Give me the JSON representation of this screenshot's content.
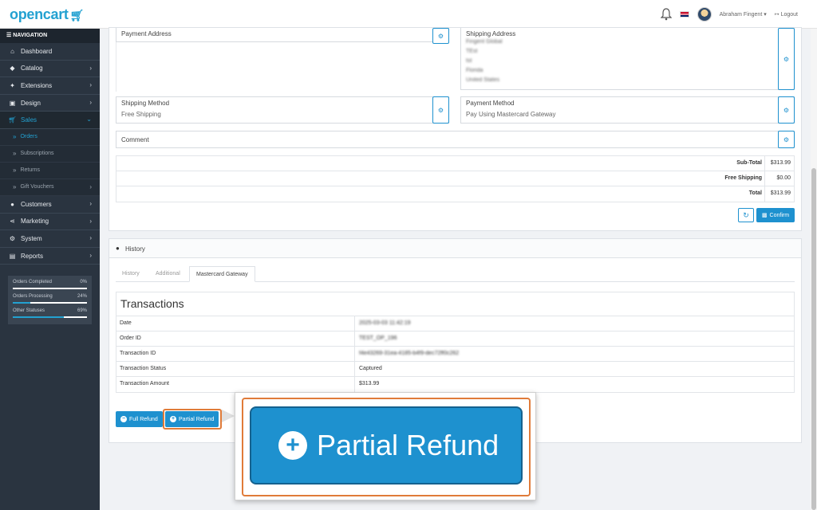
{
  "header": {
    "logo": "opencart",
    "user_name": "Abraham Fingent",
    "logout_label": "Logout"
  },
  "sidebar": {
    "heading": "NAVIGATION",
    "items": [
      {
        "label": "Dashboard",
        "icon": "home-icon"
      },
      {
        "label": "Catalog",
        "icon": "tag-icon"
      },
      {
        "label": "Extensions",
        "icon": "puzzle-icon"
      },
      {
        "label": "Design",
        "icon": "monitor-icon"
      },
      {
        "label": "Sales",
        "icon": "cart-icon"
      },
      {
        "label": "Customers",
        "icon": "user-icon"
      },
      {
        "label": "Marketing",
        "icon": "share-icon"
      },
      {
        "label": "System",
        "icon": "cog-icon"
      },
      {
        "label": "Reports",
        "icon": "chart-icon"
      }
    ],
    "sales_sub": [
      {
        "label": "Orders"
      },
      {
        "label": "Subscriptions"
      },
      {
        "label": "Returns"
      },
      {
        "label": "Gift Vouchers"
      }
    ],
    "stats": [
      {
        "label": "Orders Completed",
        "pct": "0%",
        "value": 0
      },
      {
        "label": "Orders Processing",
        "pct": "24%",
        "value": 0.24
      },
      {
        "label": "Other Statuses",
        "pct": "69%",
        "value": 0.69
      }
    ]
  },
  "order": {
    "payment_address_title": "Payment Address",
    "shipping_address_title": "Shipping Address",
    "shipping_address_lines": [
      "Fingent Global",
      "TEst",
      "tst",
      "Florida",
      "United States"
    ],
    "shipping_method_title": "Shipping Method",
    "shipping_method_value": "Free Shipping",
    "payment_method_title": "Payment Method",
    "payment_method_value": "Pay Using Mastercard Gateway",
    "comment_title": "Comment",
    "totals": [
      {
        "label": "Sub-Total",
        "value": "$313.99"
      },
      {
        "label": "Free Shipping",
        "value": "$0.00"
      },
      {
        "label": "Total",
        "value": "$313.99"
      }
    ],
    "confirm_label": "Confirm"
  },
  "history": {
    "title": "History",
    "tabs": [
      "History",
      "Additional",
      "Mastercard Gateway"
    ],
    "active_tab": 2,
    "transactions_title": "Transactions",
    "rows": [
      {
        "key": "Date",
        "value": "2025-03-03 11:42:19",
        "blurred": true
      },
      {
        "key": "Order ID",
        "value": "TEST_OP_196",
        "blurred": true
      },
      {
        "key": "Transaction ID",
        "value": "f4e43269-31ea-4185-b4f9-dec72ff0c262",
        "blurred": true
      },
      {
        "key": "Transaction Status",
        "value": "Captured",
        "blurred": false
      },
      {
        "key": "Transaction Amount",
        "value": "$313.99",
        "blurred": false
      }
    ],
    "full_refund_label": "Full Refund",
    "partial_refund_label": "Partial Refund"
  },
  "callout": {
    "label": "Partial Refund"
  },
  "colors": {
    "brand": "#23a1d1",
    "button": "#1e91cf",
    "highlight": "#e07b39",
    "sidebar": "#2a3440"
  }
}
